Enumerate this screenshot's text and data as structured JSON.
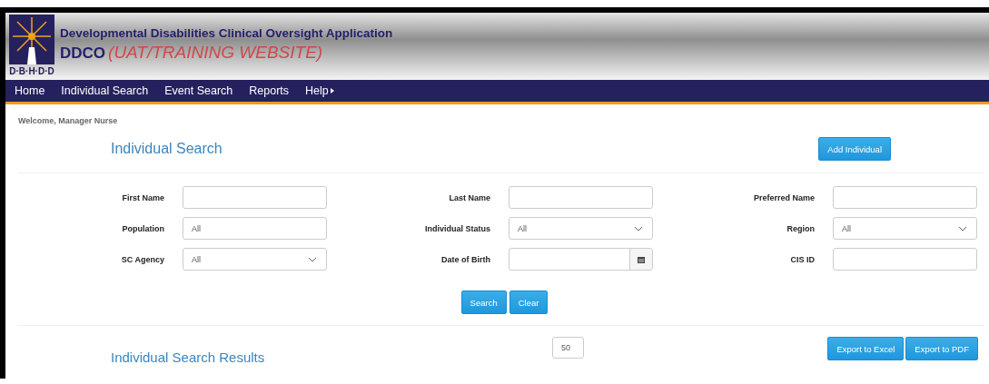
{
  "header": {
    "logo_text": "D·B·H·D·D",
    "title": "Developmental Disabilities Clinical Oversight Application",
    "app_name": "DDCO",
    "environment": "(UAT/TRAINING WEBSITE)"
  },
  "nav": [
    {
      "label": "Home",
      "submenu": false
    },
    {
      "label": "Individual Search",
      "submenu": false
    },
    {
      "label": "Event Search",
      "submenu": false
    },
    {
      "label": "Reports",
      "submenu": false
    },
    {
      "label": "Help",
      "submenu": true
    }
  ],
  "welcome": "Welcome, Manager Nurse",
  "page_title": "Individual Search",
  "add_button": "Add Individual",
  "fields": [
    {
      "label": "First Name",
      "kind": "text"
    },
    {
      "label": "Last Name",
      "kind": "text"
    },
    {
      "label": "Preferred Name",
      "kind": "text"
    },
    {
      "label": "Population",
      "kind": "text",
      "value": "All"
    },
    {
      "label": "Individual Status",
      "kind": "select",
      "value": "All"
    },
    {
      "label": "Region",
      "kind": "select",
      "value": "All"
    },
    {
      "label": "SC Agency",
      "kind": "select",
      "value": "All"
    },
    {
      "label": "Date of Birth",
      "kind": "date"
    },
    {
      "label": "CIS ID",
      "kind": "text"
    }
  ],
  "form_buttons": [
    "Search",
    "Clear"
  ],
  "results": {
    "title": "Individual Search Results",
    "page_size": "50",
    "export_buttons": [
      "Export to Excel",
      "Export to PDF"
    ]
  }
}
